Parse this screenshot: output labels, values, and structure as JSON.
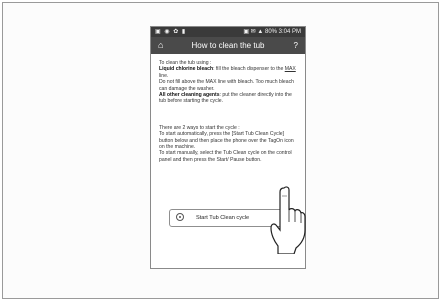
{
  "status_bar": {
    "left_icons": "▣ ◉ ✿ ▮",
    "right_text": "▣ ✉ ▲ 80% 3:04 PM"
  },
  "header": {
    "home_icon": "home-icon",
    "title": "How to clean the tub",
    "help_label": "?"
  },
  "instructions": {
    "intro": "To clean the tub using :",
    "bleach_bold": "Liquid chlorine bleach",
    "bleach_rest_a": ": fill the bleach dispenser to the ",
    "bleach_max": "MAX",
    "bleach_rest_b": " line.",
    "warning": "Do not fill above the MAX line with bleach. Too much bleach can damage the washer.",
    "other_bold": "All other cleaning agents",
    "other_rest": ": put the cleaner directly into the tub before starting the cycle.",
    "ways_intro": "There are 2 ways to start the cycle :",
    "auto": "To start automatically, press the [Start Tub Clean Cycle] button below and then place the phone over the TagOn icon on the machine.",
    "manual": "To start manually, select the Tub Clean cycle on the control panel and then press the Start/ Pause button."
  },
  "start_button": {
    "icon": "tag-on-icon",
    "label": "Start Tub Clean cycle"
  },
  "overlay": {
    "hand_icon": "pointing-hand-icon"
  }
}
